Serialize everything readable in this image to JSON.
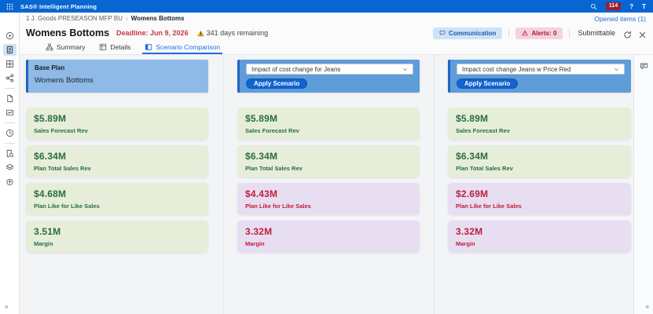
{
  "topbar": {
    "title": "SAS® Intelligent Planning",
    "badge_count": "114",
    "help_label": "?",
    "avatar_label": "T"
  },
  "sidebar": {
    "items": [
      {
        "icon": "explore-icon"
      },
      {
        "icon": "report-icon",
        "selected": true
      },
      {
        "icon": "grid-icon"
      },
      {
        "icon": "share-icon"
      },
      {
        "divider": true
      },
      {
        "icon": "document-icon"
      },
      {
        "icon": "chart-icon"
      },
      {
        "divider": true
      },
      {
        "icon": "clock-settings-icon"
      },
      {
        "divider": true
      },
      {
        "icon": "document-search-icon"
      },
      {
        "icon": "stack-icon"
      },
      {
        "icon": "clock-upload-icon"
      }
    ],
    "expand_label": "»"
  },
  "rail": {
    "collapse_label": "«"
  },
  "breadcrumb": {
    "parent": "1 J. Goods PRESEASON MFP BU",
    "separator": "›",
    "current": "Womens Bottoms"
  },
  "opened_items_label": "Opened items (1)",
  "page_header": {
    "title": "Womens Bottoms",
    "deadline": "Deadline: Jun 9, 2026",
    "days_remaining": "341 days remaining",
    "communication_label": "Communication",
    "alerts_label": "Alerts: 0",
    "submittable_label": "Submittable"
  },
  "tabs": [
    {
      "label": "Summary",
      "icon": "summary-icon",
      "active": false
    },
    {
      "label": "Details",
      "icon": "details-icon",
      "active": false
    },
    {
      "label": "Scenario Comparison",
      "icon": "comparison-icon",
      "active": true
    }
  ],
  "comparison": {
    "base_column": {
      "title": "Base Plan",
      "subtitle": "Womens Bottoms",
      "metrics": [
        {
          "value": "$5.89M",
          "label": "Sales Forecast Rev",
          "status": "positive"
        },
        {
          "value": "$6.34M",
          "label": "Plan Total Sales Rev",
          "status": "positive"
        },
        {
          "value": "$4.68M",
          "label": "Plan Like for Like Sales",
          "status": "positive"
        },
        {
          "value": "3.51M",
          "label": "Margin",
          "status": "positive"
        }
      ]
    },
    "scenario_columns": [
      {
        "dropdown_value": "Impact of cost change for Jeans",
        "apply_label": "Apply Scenario",
        "metrics": [
          {
            "value": "$5.89M",
            "label": "Sales Forecast Rev",
            "status": "positive"
          },
          {
            "value": "$6.34M",
            "label": "Plan Total Sales Rev",
            "status": "positive"
          },
          {
            "value": "$4.43M",
            "label": "Plan Like for Like Sales",
            "status": "negative"
          },
          {
            "value": "3.32M",
            "label": "Margin",
            "status": "negative"
          }
        ]
      },
      {
        "dropdown_value": "Impact cost change Jeans w Price Red",
        "apply_label": "Apply Scenario",
        "metrics": [
          {
            "value": "$5.89M",
            "label": "Sales Forecast Rev",
            "status": "positive"
          },
          {
            "value": "$6.34M",
            "label": "Plan Total Sales Rev",
            "status": "positive"
          },
          {
            "value": "$2.69M",
            "label": "Plan Like for Like Sales",
            "status": "negative"
          },
          {
            "value": "3.32M",
            "label": "Margin",
            "status": "negative"
          }
        ]
      }
    ]
  },
  "colors": {
    "topbar-blue": "#0766d1",
    "badge-red": "#9e1b32",
    "link-blue": "#1f6fd6",
    "deadline-red": "#c43a3f",
    "warning-amber": "#e8a723",
    "base-panel-blue": "#8fb9e6",
    "scenario-panel-blue": "#5f9cda",
    "panel-border-blue": "#2263c3",
    "apply-btn-blue": "#1263cf",
    "positive-bg": "#e6eeda",
    "positive-text": "#2a6d43",
    "negative-bg": "#e8def2",
    "negative-text": "#c01d38",
    "comm-pill-bg": "#cfe2f8",
    "comm-pill-text": "#1c5bb0",
    "alert-pill-bg": "#f6d2dd",
    "alert-pill-text": "#9c1d33"
  }
}
